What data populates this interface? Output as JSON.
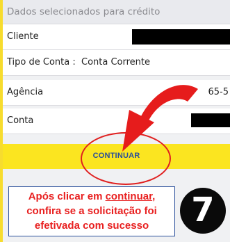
{
  "section_title": "Dados selecionados para crédito",
  "rows": {
    "cliente": {
      "label": "Cliente"
    },
    "tipo_conta": {
      "label": "Tipo de Conta :",
      "value": "Conta Corrente"
    },
    "agencia": {
      "label": "Agência",
      "value": "65-5"
    },
    "conta": {
      "label": "Conta"
    }
  },
  "continue_button": {
    "label": "CONTINUAR"
  },
  "annotation": {
    "line1_prefix": "Após clicar em ",
    "line1_link": "continuar",
    "line1_suffix": ",",
    "line2": "confira se a solicitação foi",
    "line3": "efetivada com sucesso",
    "step_number": "7"
  },
  "colors": {
    "accent_yellow": "#f7dc2e",
    "annotation_red": "#e02020",
    "button_text": "#2a4f9a"
  }
}
